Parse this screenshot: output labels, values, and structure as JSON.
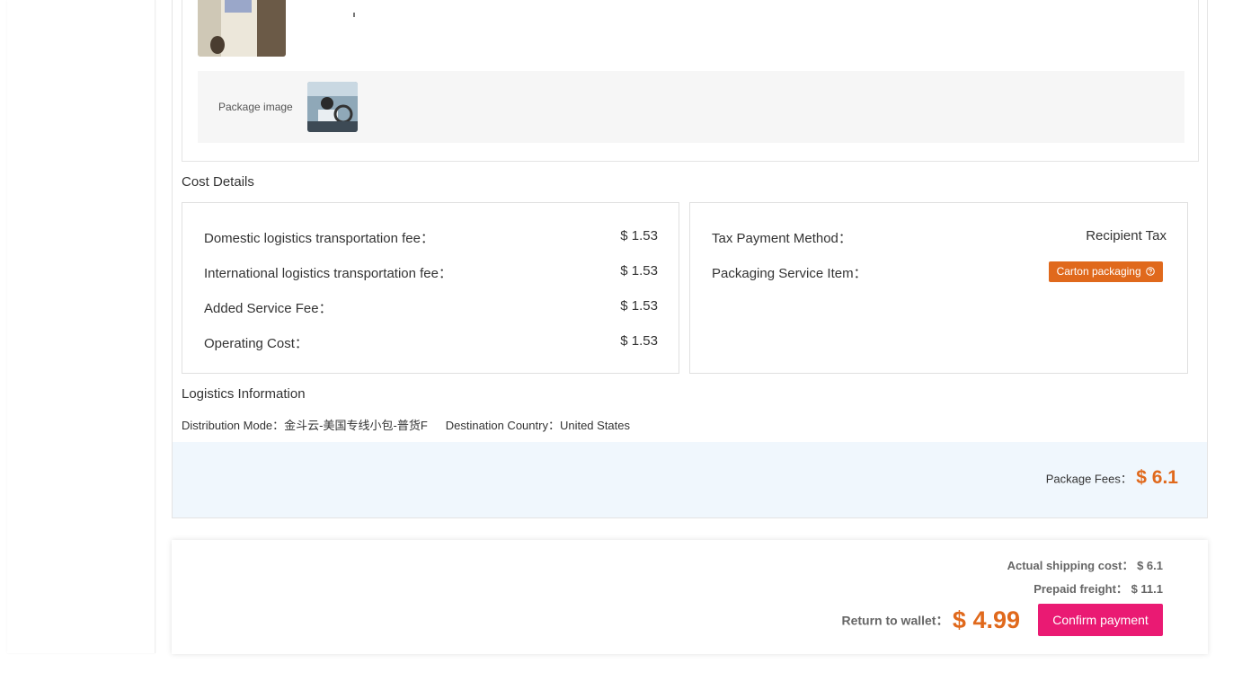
{
  "product": {
    "thumbnail_icon": "product-photo-icon"
  },
  "package": {
    "label": "Package image",
    "thumbnail_icon": "package-photo-icon"
  },
  "cost_details": {
    "title": "Cost Details",
    "left_rows": [
      {
        "label": "Domestic logistics transportation fee：",
        "value": "$ 1.53"
      },
      {
        "label": "International logistics transportation fee：",
        "value": "$ 1.53"
      },
      {
        "label": "Added Service Fee：",
        "value": "$ 1.53"
      },
      {
        "label": "Operating Cost：",
        "value": "$ 1.53"
      }
    ],
    "tax_label": "Tax Payment Method：",
    "tax_value": "Recipient Tax",
    "packaging_label": "Packaging Service Item：",
    "packaging_badge": "Carton packaging",
    "packaging_badge_icon": "question-circle-icon"
  },
  "logistics": {
    "title": "Logistics Information",
    "distribution_label": "Distribution Mode：",
    "distribution_value": "金斗云-美国专线小包-普货F",
    "destination_label": "Destination Country：",
    "destination_value": "United States"
  },
  "package_fees": {
    "label": "Package Fees：",
    "value": "$ 6.1"
  },
  "payment": {
    "actual_label": "Actual shipping cost：",
    "actual_value": "$ 6.1",
    "prepaid_label": "Prepaid freight：",
    "prepaid_value": "$ 11.1",
    "return_label": "Return to wallet：",
    "return_value": "$ 4.99",
    "confirm_label": "Confirm payment"
  },
  "colors": {
    "accent_orange": "#e0691c",
    "confirm_pink": "#ea1a73",
    "fees_band": "#f0f7fd"
  }
}
